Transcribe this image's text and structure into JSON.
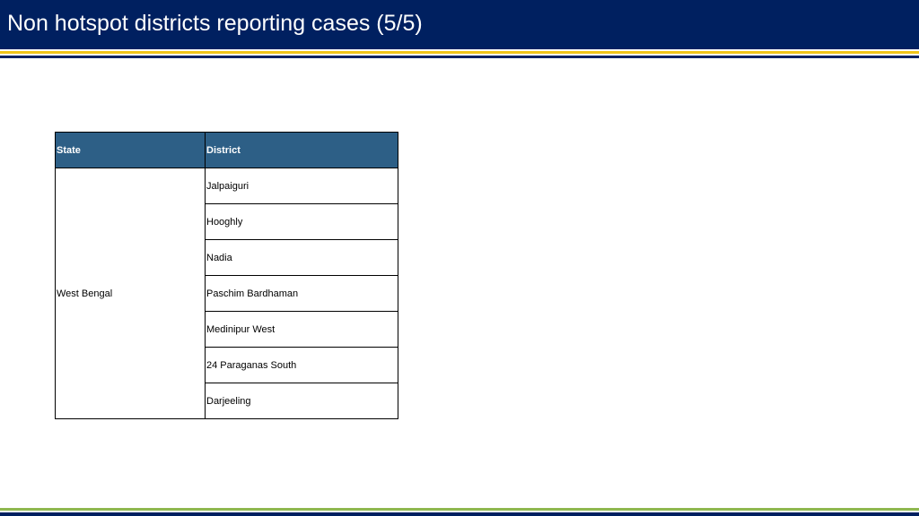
{
  "slide": {
    "title": "Non hotspot districts reporting cases (5/5)"
  },
  "table": {
    "headers": {
      "state": "State",
      "district": "District"
    },
    "state": "West Bengal",
    "districts": [
      "Jalpaiguri",
      "Hooghly",
      "Nadia",
      "Paschim Bardhaman",
      "Medinipur West",
      "24 Paraganas South",
      "Darjeeling"
    ]
  },
  "colors": {
    "title_bar": "#002060",
    "accent_gold": "#f0c419",
    "header_fill": "#2d5f86",
    "footer_green": "#8fb84f"
  }
}
